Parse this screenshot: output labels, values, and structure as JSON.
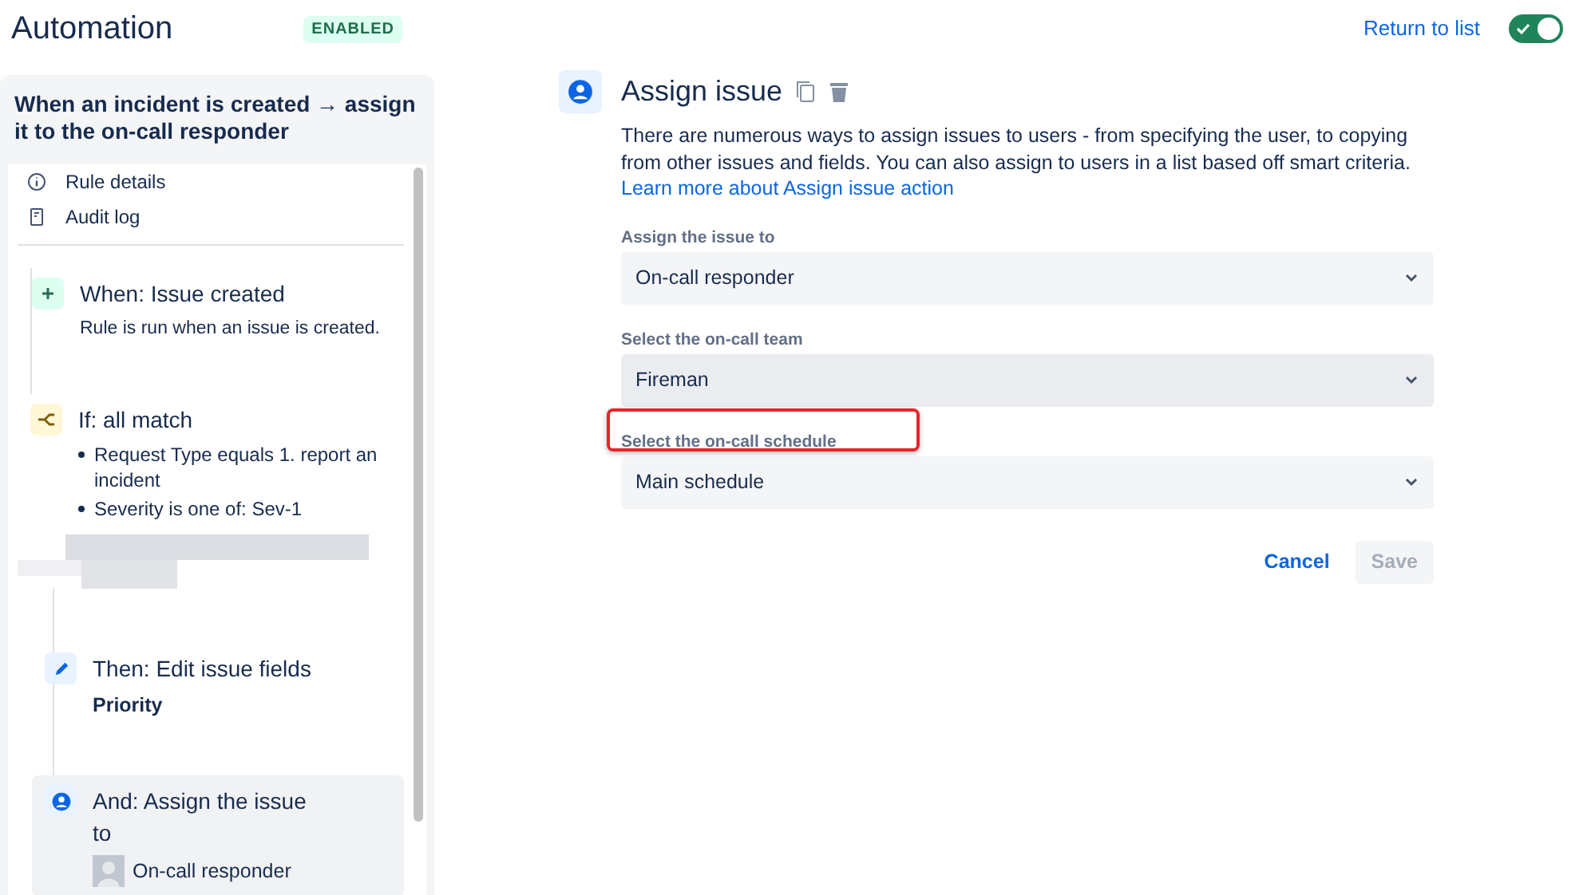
{
  "header": {
    "title": "Automation",
    "badge": "ENABLED",
    "return_link": "Return to list",
    "toggle": {
      "on": true
    }
  },
  "rule": {
    "title": "When an incident is created → assign it to the on-call responder",
    "nav": [
      {
        "kind": "info",
        "label": "Rule details"
      },
      {
        "kind": "log",
        "label": "Audit log"
      }
    ],
    "steps": [
      {
        "kind": "trigger",
        "title": "When: Issue created",
        "description": "Rule is run when an issue is created."
      },
      {
        "kind": "condition",
        "title": "If: all match",
        "bullets": [
          "Request Type equals 1. report an incident",
          "Severity is one of: Sev-1"
        ],
        "redacted": true,
        "children": [
          {
            "kind": "edit",
            "title": "Then: Edit issue fields",
            "detail": "Priority",
            "selected": false
          },
          {
            "kind": "assign",
            "title": "And: Assign the issue to",
            "assignee": "On-call responder",
            "selected": true
          }
        ]
      }
    ]
  },
  "panel": {
    "title": "Assign issue",
    "description": "There are numerous ways to assign issues to users - from specifying the user, to copying from other issues and fields. You can also assign to users in a list based off smart criteria.",
    "link": "Learn more about Assign issue action",
    "fields": [
      {
        "label": "Assign the issue to",
        "value": "On-call responder",
        "hovered": false,
        "annotated": false
      },
      {
        "label": "Select the on-call team",
        "value": "Fireman",
        "hovered": true,
        "annotated": false
      },
      {
        "label": "Select the on-call schedule",
        "value": "Main schedule",
        "hovered": false,
        "annotated": true
      }
    ],
    "cancel": "Cancel",
    "save": {
      "label": "Save",
      "disabled": true
    }
  }
}
